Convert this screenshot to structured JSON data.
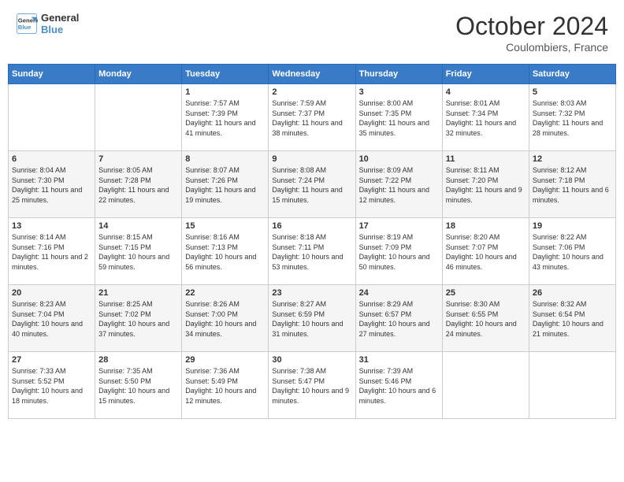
{
  "header": {
    "logo_line1": "General",
    "logo_line2": "Blue",
    "month": "October 2024",
    "location": "Coulombiers, France"
  },
  "weekdays": [
    "Sunday",
    "Monday",
    "Tuesday",
    "Wednesday",
    "Thursday",
    "Friday",
    "Saturday"
  ],
  "weeks": [
    [
      {
        "day": "",
        "info": ""
      },
      {
        "day": "",
        "info": ""
      },
      {
        "day": "1",
        "info": "Sunrise: 7:57 AM\nSunset: 7:39 PM\nDaylight: 11 hours and 41 minutes."
      },
      {
        "day": "2",
        "info": "Sunrise: 7:59 AM\nSunset: 7:37 PM\nDaylight: 11 hours and 38 minutes."
      },
      {
        "day": "3",
        "info": "Sunrise: 8:00 AM\nSunset: 7:35 PM\nDaylight: 11 hours and 35 minutes."
      },
      {
        "day": "4",
        "info": "Sunrise: 8:01 AM\nSunset: 7:34 PM\nDaylight: 11 hours and 32 minutes."
      },
      {
        "day": "5",
        "info": "Sunrise: 8:03 AM\nSunset: 7:32 PM\nDaylight: 11 hours and 28 minutes."
      }
    ],
    [
      {
        "day": "6",
        "info": "Sunrise: 8:04 AM\nSunset: 7:30 PM\nDaylight: 11 hours and 25 minutes."
      },
      {
        "day": "7",
        "info": "Sunrise: 8:05 AM\nSunset: 7:28 PM\nDaylight: 11 hours and 22 minutes."
      },
      {
        "day": "8",
        "info": "Sunrise: 8:07 AM\nSunset: 7:26 PM\nDaylight: 11 hours and 19 minutes."
      },
      {
        "day": "9",
        "info": "Sunrise: 8:08 AM\nSunset: 7:24 PM\nDaylight: 11 hours and 15 minutes."
      },
      {
        "day": "10",
        "info": "Sunrise: 8:09 AM\nSunset: 7:22 PM\nDaylight: 11 hours and 12 minutes."
      },
      {
        "day": "11",
        "info": "Sunrise: 8:11 AM\nSunset: 7:20 PM\nDaylight: 11 hours and 9 minutes."
      },
      {
        "day": "12",
        "info": "Sunrise: 8:12 AM\nSunset: 7:18 PM\nDaylight: 11 hours and 6 minutes."
      }
    ],
    [
      {
        "day": "13",
        "info": "Sunrise: 8:14 AM\nSunset: 7:16 PM\nDaylight: 11 hours and 2 minutes."
      },
      {
        "day": "14",
        "info": "Sunrise: 8:15 AM\nSunset: 7:15 PM\nDaylight: 10 hours and 59 minutes."
      },
      {
        "day": "15",
        "info": "Sunrise: 8:16 AM\nSunset: 7:13 PM\nDaylight: 10 hours and 56 minutes."
      },
      {
        "day": "16",
        "info": "Sunrise: 8:18 AM\nSunset: 7:11 PM\nDaylight: 10 hours and 53 minutes."
      },
      {
        "day": "17",
        "info": "Sunrise: 8:19 AM\nSunset: 7:09 PM\nDaylight: 10 hours and 50 minutes."
      },
      {
        "day": "18",
        "info": "Sunrise: 8:20 AM\nSunset: 7:07 PM\nDaylight: 10 hours and 46 minutes."
      },
      {
        "day": "19",
        "info": "Sunrise: 8:22 AM\nSunset: 7:06 PM\nDaylight: 10 hours and 43 minutes."
      }
    ],
    [
      {
        "day": "20",
        "info": "Sunrise: 8:23 AM\nSunset: 7:04 PM\nDaylight: 10 hours and 40 minutes."
      },
      {
        "day": "21",
        "info": "Sunrise: 8:25 AM\nSunset: 7:02 PM\nDaylight: 10 hours and 37 minutes."
      },
      {
        "day": "22",
        "info": "Sunrise: 8:26 AM\nSunset: 7:00 PM\nDaylight: 10 hours and 34 minutes."
      },
      {
        "day": "23",
        "info": "Sunrise: 8:27 AM\nSunset: 6:59 PM\nDaylight: 10 hours and 31 minutes."
      },
      {
        "day": "24",
        "info": "Sunrise: 8:29 AM\nSunset: 6:57 PM\nDaylight: 10 hours and 27 minutes."
      },
      {
        "day": "25",
        "info": "Sunrise: 8:30 AM\nSunset: 6:55 PM\nDaylight: 10 hours and 24 minutes."
      },
      {
        "day": "26",
        "info": "Sunrise: 8:32 AM\nSunset: 6:54 PM\nDaylight: 10 hours and 21 minutes."
      }
    ],
    [
      {
        "day": "27",
        "info": "Sunrise: 7:33 AM\nSunset: 5:52 PM\nDaylight: 10 hours and 18 minutes."
      },
      {
        "day": "28",
        "info": "Sunrise: 7:35 AM\nSunset: 5:50 PM\nDaylight: 10 hours and 15 minutes."
      },
      {
        "day": "29",
        "info": "Sunrise: 7:36 AM\nSunset: 5:49 PM\nDaylight: 10 hours and 12 minutes."
      },
      {
        "day": "30",
        "info": "Sunrise: 7:38 AM\nSunset: 5:47 PM\nDaylight: 10 hours and 9 minutes."
      },
      {
        "day": "31",
        "info": "Sunrise: 7:39 AM\nSunset: 5:46 PM\nDaylight: 10 hours and 6 minutes."
      },
      {
        "day": "",
        "info": ""
      },
      {
        "day": "",
        "info": ""
      }
    ]
  ]
}
